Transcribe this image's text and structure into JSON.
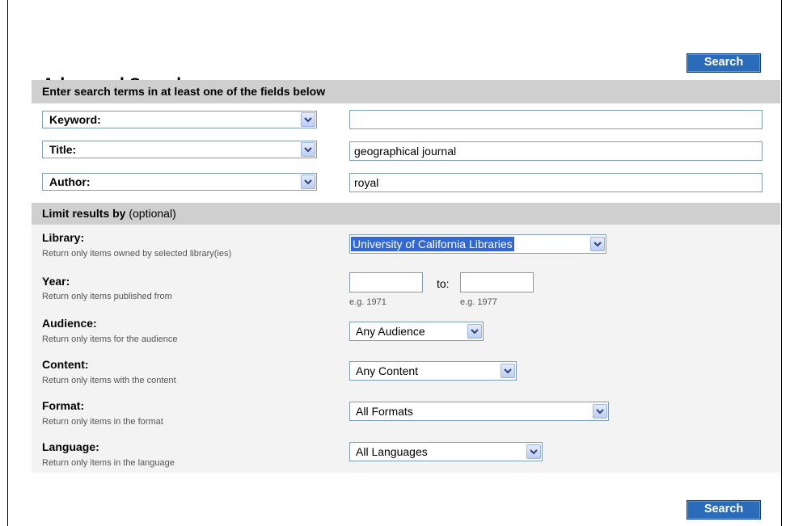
{
  "header": {
    "title": "Advanced Search",
    "search_button": "Search"
  },
  "terms_section": {
    "heading": "Enter search terms in at least one of the fields below",
    "rows": [
      {
        "field": "Keyword:",
        "value": ""
      },
      {
        "field": "Title:",
        "value": "geographical journal"
      },
      {
        "field": "Author:",
        "value": "royal"
      }
    ]
  },
  "limit_section": {
    "heading": "Limit results by",
    "heading_optional": "(optional)",
    "library": {
      "label": "Library:",
      "help": "Return only items owned by selected library(ies)",
      "selected": "University of California Libraries"
    },
    "year": {
      "label": "Year:",
      "help": "Return only items published from",
      "to_label": "to:",
      "from_value": "",
      "to_value": "",
      "from_example": "e.g. 1971",
      "to_example": "e.g. 1977"
    },
    "audience": {
      "label": "Audience:",
      "help": "Return only items for the audience",
      "selected": "Any Audience"
    },
    "content": {
      "label": "Content:",
      "help": "Return only items with the content",
      "selected": "Any Content"
    },
    "format": {
      "label": "Format:",
      "help": "Return only items in the format",
      "selected": "All Formats"
    },
    "language": {
      "label": "Language:",
      "help": "Return only items in the language",
      "selected": "All Languages"
    }
  },
  "footer": {
    "search_button": "Search"
  },
  "colors": {
    "button": "#2a6cba",
    "section_bar": "#cfcfcf",
    "limit_bg": "#f3f3f3",
    "highlight": "#3168d5"
  }
}
